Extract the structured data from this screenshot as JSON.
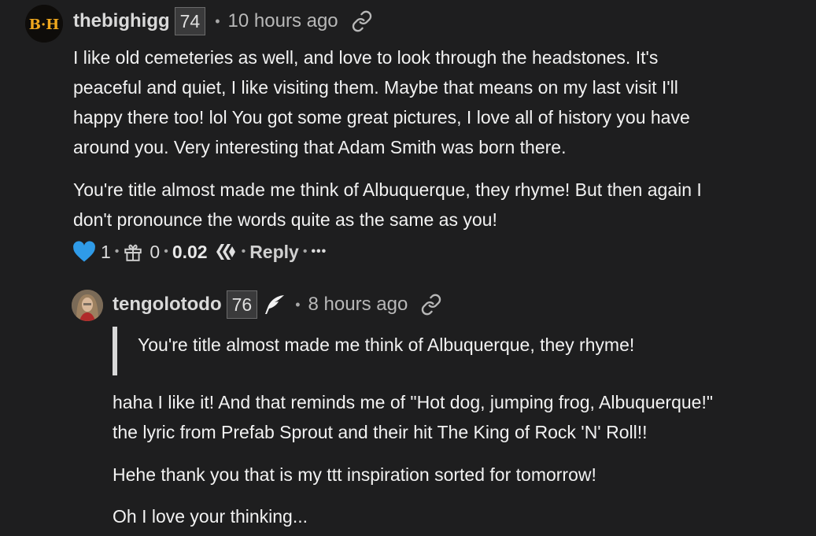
{
  "comment1": {
    "author": "thebighigg",
    "reputation": "74",
    "time": "10 hours ago",
    "paragraphs": [
      "I like old cemeteries as well, and love to look through the headstones. It's",
      "peaceful and quiet, I like visiting them. Maybe that means on my last visit I'll",
      "happy there too! lol You got some great pictures, I love all of history you have",
      "around you. Very interesting that Adam Smith was born there.",
      "You're title almost made me think of Albuquerque, they rhyme! But then again I",
      "don't pronounce the words quite as the same as you!"
    ],
    "actions": {
      "likes": "1",
      "gifts": "0",
      "payout": "0.02",
      "reply_label": "Reply",
      "more_label": "•••"
    },
    "avatar_text": "B·H"
  },
  "comment2": {
    "author": "tengolotodo",
    "reputation": "76",
    "time": "8 hours ago",
    "quote": "You're title almost made me think of Albuquerque, they rhyme!",
    "paragraphs": [
      "haha I like it! And that reminds me of \"Hot dog, jumping frog, Albuquerque!\"",
      "the lyric from Prefab Sprout and their hit The King of Rock 'N' Roll!!",
      "Hehe thank you that is my ttt inspiration sorted for tomorrow!",
      "Oh I love your thinking..."
    ]
  },
  "colors": {
    "background": "#1e1e1f",
    "heart": "#2f9be8",
    "text": "#f2f2f2",
    "muted": "#b8b8b8"
  },
  "icons": [
    "link-icon",
    "heart-icon",
    "gift-icon",
    "hive-icon",
    "quill-icon"
  ]
}
